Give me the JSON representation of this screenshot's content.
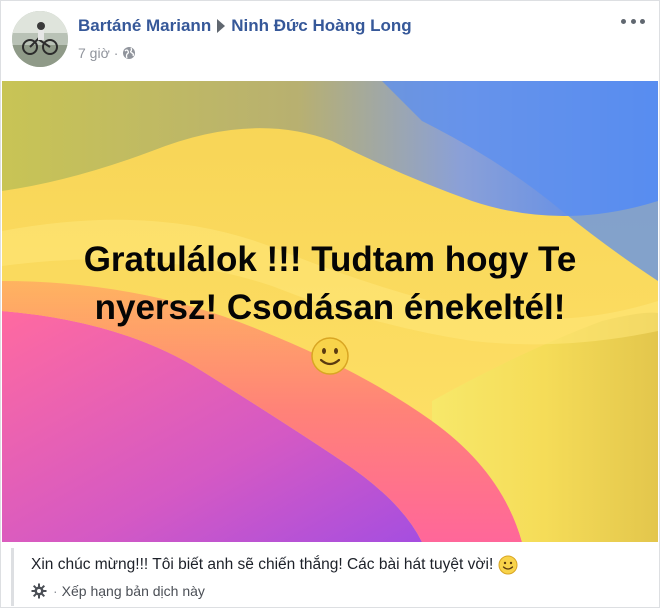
{
  "post": {
    "author": "Bartáné Mariann",
    "recipient": "Ninh Đức Hoàng Long",
    "time": "7 giờ",
    "meta_separator": "·",
    "privacy_icon": "globe-icon",
    "more_icon": "more-options-icon",
    "message": "Gratulálok !!! Tudtam hogy Te nyersz! Csodásan énekeltél!",
    "message_emoji": "smiley-icon",
    "background_colors": [
      "#f7d84a",
      "#ff8a6b",
      "#ff5c97",
      "#b04dd6",
      "#5a8bf0",
      "#9fd06a"
    ]
  },
  "translation": {
    "text": "Xin chúc mừng!!! Tôi biết anh sẽ chiến thắng! Các bài hát tuyệt vời!",
    "separator": "·",
    "rate_label": "Xếp hạng bản dịch này"
  }
}
